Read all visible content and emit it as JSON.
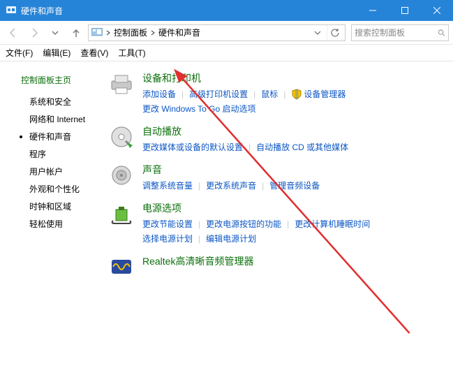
{
  "titlebar": {
    "title": "硬件和声音"
  },
  "addrbar": {
    "seg1": "控制面板",
    "seg2": "硬件和声音",
    "search_placeholder": "搜索控制面板"
  },
  "menubar": {
    "file": "文件(F)",
    "edit": "编辑(E)",
    "view": "查看(V)",
    "tools": "工具(T)"
  },
  "sidebar": {
    "heading": "控制面板主页",
    "items": [
      "系统和安全",
      "网络和 Internet",
      "硬件和声音",
      "程序",
      "用户帐户",
      "外观和个性化",
      "时钟和区域",
      "轻松使用"
    ],
    "active_index": 2
  },
  "main": {
    "cat_devices": {
      "title": "设备和打印机",
      "link1": "添加设备",
      "link2": "高级打印机设置",
      "link3": "鼠标",
      "link4": "设备管理器",
      "link5": "更改 Windows To Go 启动选项"
    },
    "cat_autoplay": {
      "title": "自动播放",
      "link1": "更改媒体或设备的默认设置",
      "link2": "自动播放 CD 或其他媒体"
    },
    "cat_sound": {
      "title": "声音",
      "link1": "调整系统音量",
      "link2": "更改系统声音",
      "link3": "管理音频设备"
    },
    "cat_power": {
      "title": "电源选项",
      "link1": "更改节能设置",
      "link2": "更改电源按钮的功能",
      "link3": "更改计算机睡眠时间",
      "link4": "选择电源计划",
      "link5": "编辑电源计划"
    },
    "cat_realtek": {
      "title": "Realtek高清晰音频管理器"
    },
    "shield_label": "shield"
  }
}
